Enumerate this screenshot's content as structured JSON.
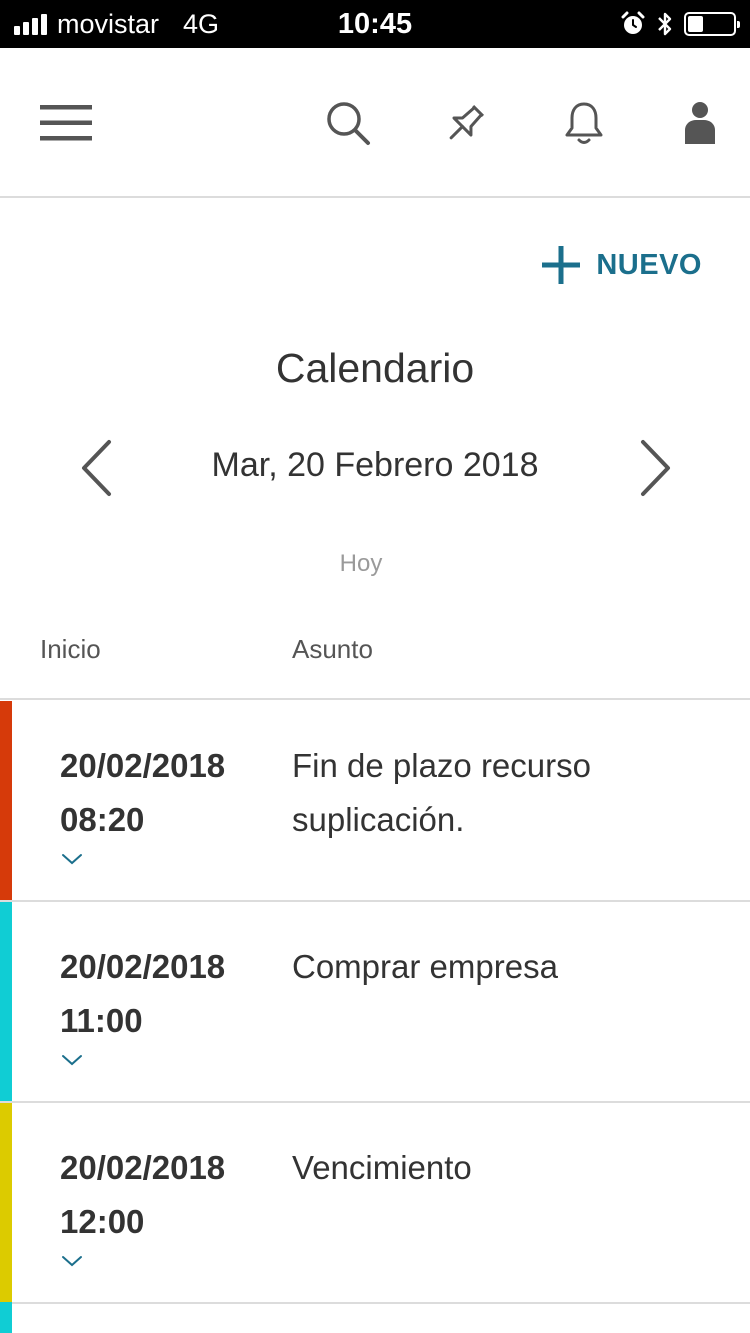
{
  "status_bar": {
    "carrier": "movistar",
    "network": "4G",
    "time": "10:45",
    "signal_bars": 4,
    "battery_level": 0.35
  },
  "header": {
    "icons": [
      "menu-icon",
      "search-icon",
      "pin-icon",
      "bell-icon",
      "user-icon"
    ]
  },
  "toolbar": {
    "new_label": "NUEVO"
  },
  "calendar": {
    "title": "Calendario",
    "current_date": "Mar, 20 Febrero 2018",
    "today_label": "Hoy"
  },
  "table": {
    "columns": [
      "Inicio",
      "Asunto"
    ]
  },
  "events": [
    {
      "date": "20/02/2018",
      "time": "08:20",
      "subject": "Fin de plazo recurso suplicación.",
      "color": "#d63a0a"
    },
    {
      "date": "20/02/2018",
      "time": "11:00",
      "subject": "Comprar empresa",
      "color": "#10cdd4"
    },
    {
      "date": "20/02/2018",
      "time": "12:00",
      "subject": "Vencimiento",
      "color": "#dccb00"
    }
  ],
  "next_event_color": "#10cdd4",
  "colors": {
    "accent": "#1b6f8c",
    "icon": "#555555",
    "divider": "#dcdcdc"
  }
}
